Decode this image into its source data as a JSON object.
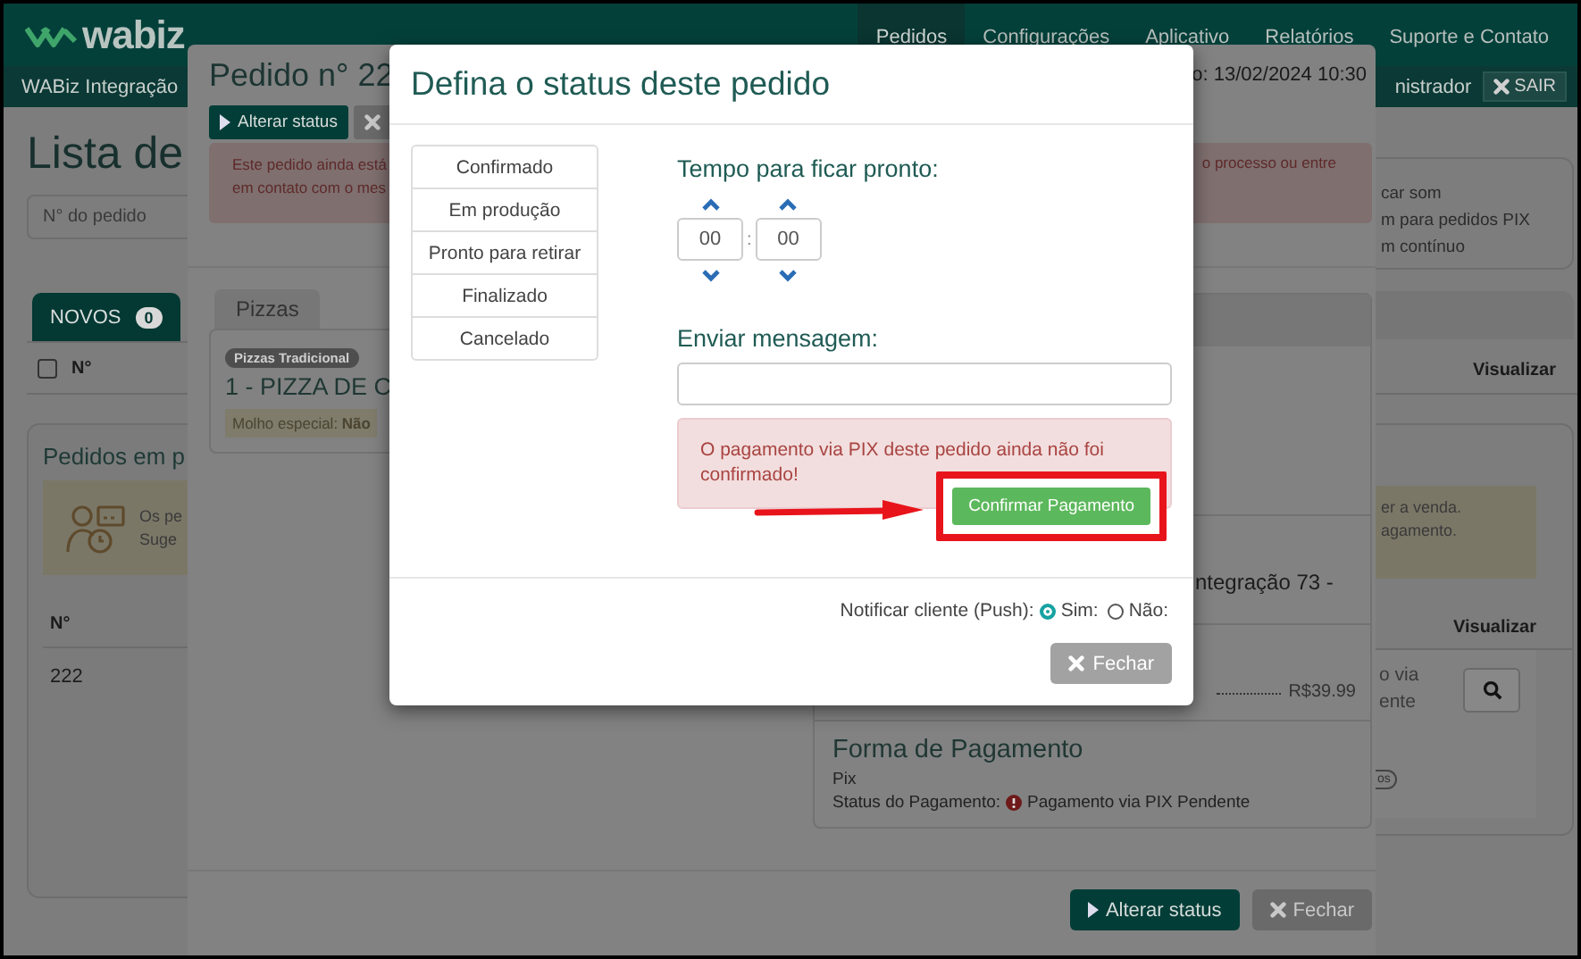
{
  "header": {
    "logo": "wabiz",
    "nav": [
      {
        "label": "Pedidos",
        "selected": true
      },
      {
        "label": "Configurações",
        "selected": false
      },
      {
        "label": "Aplicativo",
        "selected": false
      },
      {
        "label": "Relatórios",
        "selected": false
      },
      {
        "label": "Suporte e Contato",
        "selected": false
      }
    ]
  },
  "subbar": {
    "account": "WABiz Integração",
    "user": "nistrador",
    "logout": "SAIR"
  },
  "page": {
    "title": "Lista de",
    "search": {
      "placeholder": "N° do pedido"
    },
    "sound_options": [
      "car som",
      "m para pedidos PIX",
      "m contínuo"
    ],
    "tabs": [
      {
        "label": "NOVOS",
        "count": "0",
        "selected": true
      }
    ],
    "select_all_checked": false,
    "list_columns": [
      "N°",
      "Visualizar"
    ],
    "in_progress": {
      "title": "Pedidos em p",
      "notice_left": [
        "Os pe",
        "Suge"
      ],
      "notice_right": [
        "er a venda.",
        "agamento."
      ],
      "columns": [
        "N°",
        "Visualizar"
      ],
      "rows": [
        {
          "number": "222",
          "details": [
            "o via",
            "ente"
          ],
          "pill": "os"
        }
      ]
    }
  },
  "order_modal": {
    "title": "Pedido n° 22",
    "date": "o: 13/02/2024 10:30",
    "top_buttons": [
      {
        "label": "Alterar status",
        "kind": "primary"
      },
      {
        "kind": "close"
      }
    ],
    "alert_left": [
      "Este pedido ainda está",
      "em contato com o mes"
    ],
    "alert_right": "o processo ou entre",
    "category_tab": "Pizzas",
    "item": {
      "tag": "Pizzas Tradicional",
      "name": "1 - PIZZA DE C",
      "option": "Molho especial: **Não**"
    },
    "summary_line": "ntegração 73 -",
    "total": "R$39.99",
    "payment": {
      "title": "Forma de Pagamento",
      "method": "Pix",
      "status_label": "Status do Pagamento:",
      "status": "Pagamento via PIX Pendente"
    },
    "footer_buttons": [
      {
        "label": "Alterar status",
        "kind": "primary"
      },
      {
        "label": "Fechar",
        "kind": "close"
      }
    ]
  },
  "status_modal": {
    "title": "Defina o status deste pedido",
    "statuses": [
      {
        "label": "Confirmado",
        "selected": false
      },
      {
        "label": "Em produção",
        "selected": false
      },
      {
        "label": "Pronto para retirar",
        "selected": false
      },
      {
        "label": "Finalizado",
        "selected": false
      },
      {
        "label": "Cancelado",
        "selected": false
      }
    ],
    "time_label": "Tempo para ficar pronto:",
    "hours": "00",
    "minutes": "00",
    "separator": ":",
    "message_label": "Enviar mensagem:",
    "alert": "O pagamento via PIX deste pedido ainda não foi confirmado!",
    "confirm_button": "Confirmar Pagamento",
    "notify_label": "Notificar cliente (Push):",
    "notify_options": [
      {
        "label": "Sim:",
        "selected": true
      },
      {
        "label": "Não:",
        "selected": false
      }
    ],
    "close_button": "Fechar"
  }
}
